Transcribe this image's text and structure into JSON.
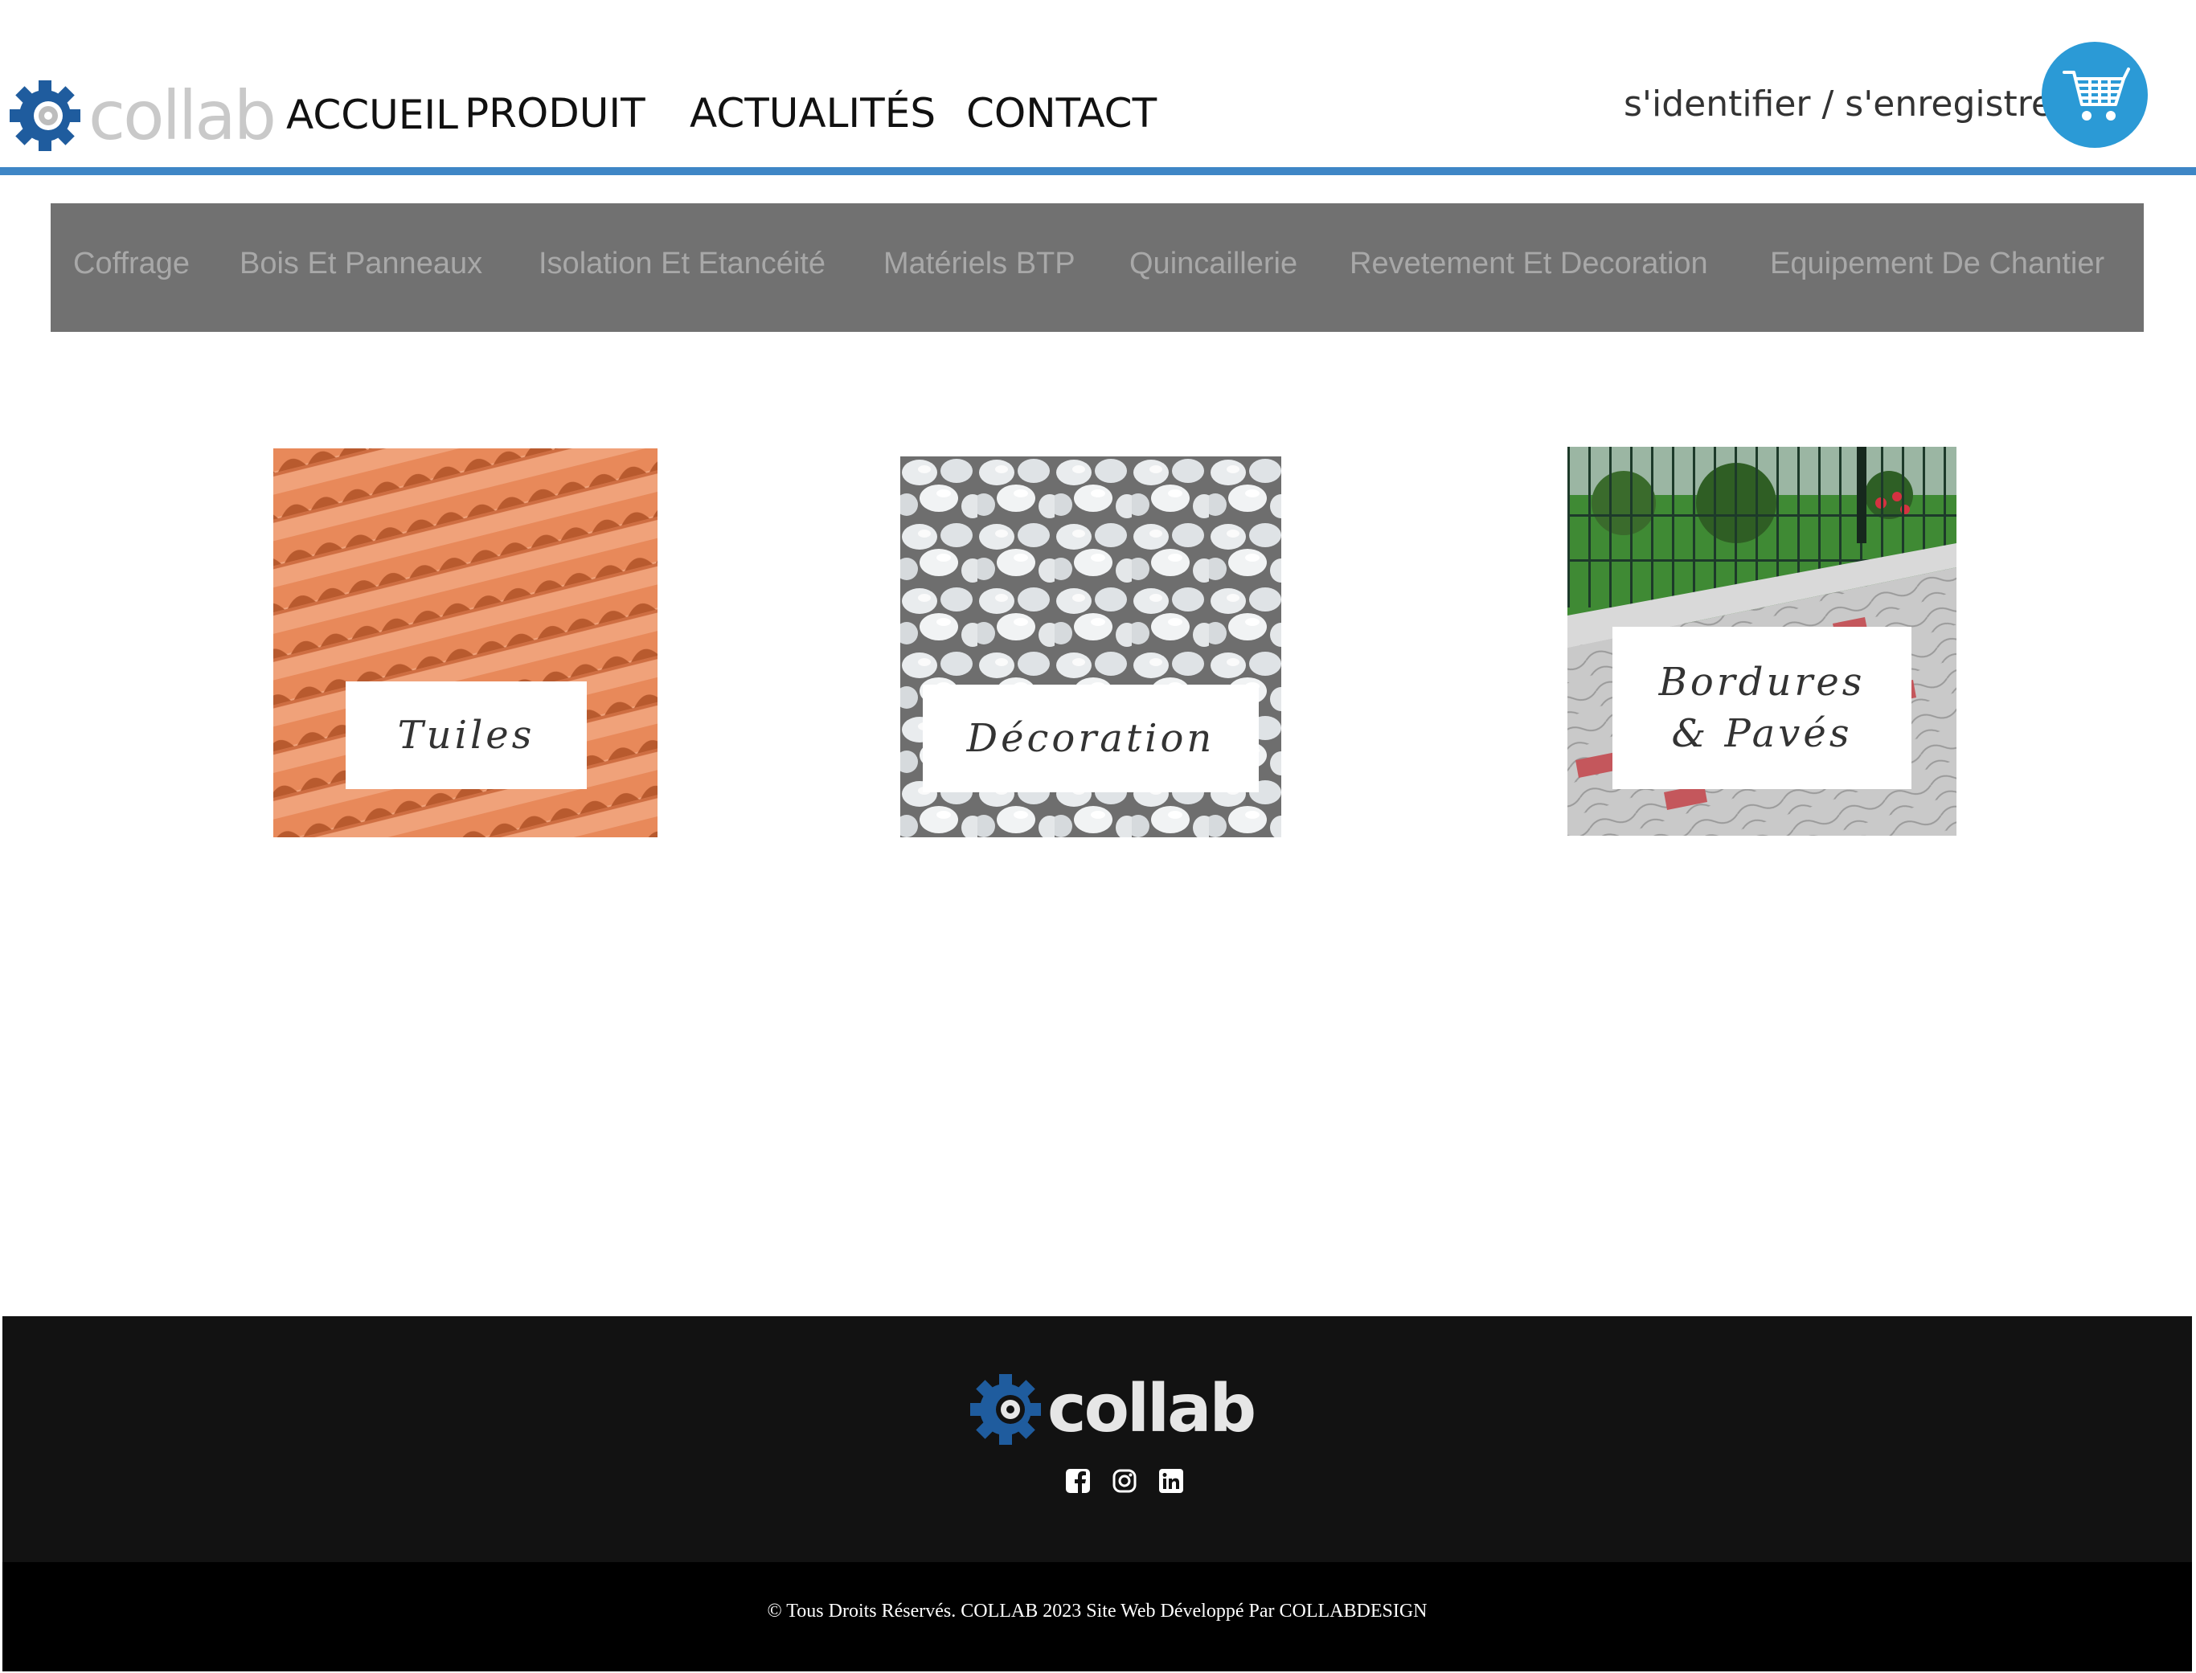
{
  "header": {
    "logo_text": "collab",
    "nav": [
      "ACCUEIL",
      "PRODUIT",
      "ACTUALITÉS",
      "CONTACT"
    ],
    "login": "s'identifier / s'enregistrer",
    "cart_icon": "cart-icon"
  },
  "categories": [
    "Coffrage",
    "Bois Et Panneaux",
    "Isolation Et Etancéité",
    "Matériels BTP",
    "Quincaillerie",
    "Revetement Et Decoration",
    "Equipement De Chantier"
  ],
  "tiles": [
    {
      "label_line1": "Tuiles",
      "label_line2": ""
    },
    {
      "label_line1": "Décoration",
      "label_line2": ""
    },
    {
      "label_line1": "Bordures",
      "label_line2": "& Pavés"
    }
  ],
  "footer": {
    "logo_text": "collab",
    "social": [
      "facebook-icon",
      "instagram-icon",
      "linkedin-icon"
    ],
    "copyright": "© Tous Droits Réservés. COLLAB 2023 Site Web Développé Par COLLABDESIGN"
  },
  "colors": {
    "accent_blue": "#3e86c6",
    "cart_blue": "#2b9ad6",
    "category_bar": "#717171",
    "footer_dark": "#121212"
  }
}
